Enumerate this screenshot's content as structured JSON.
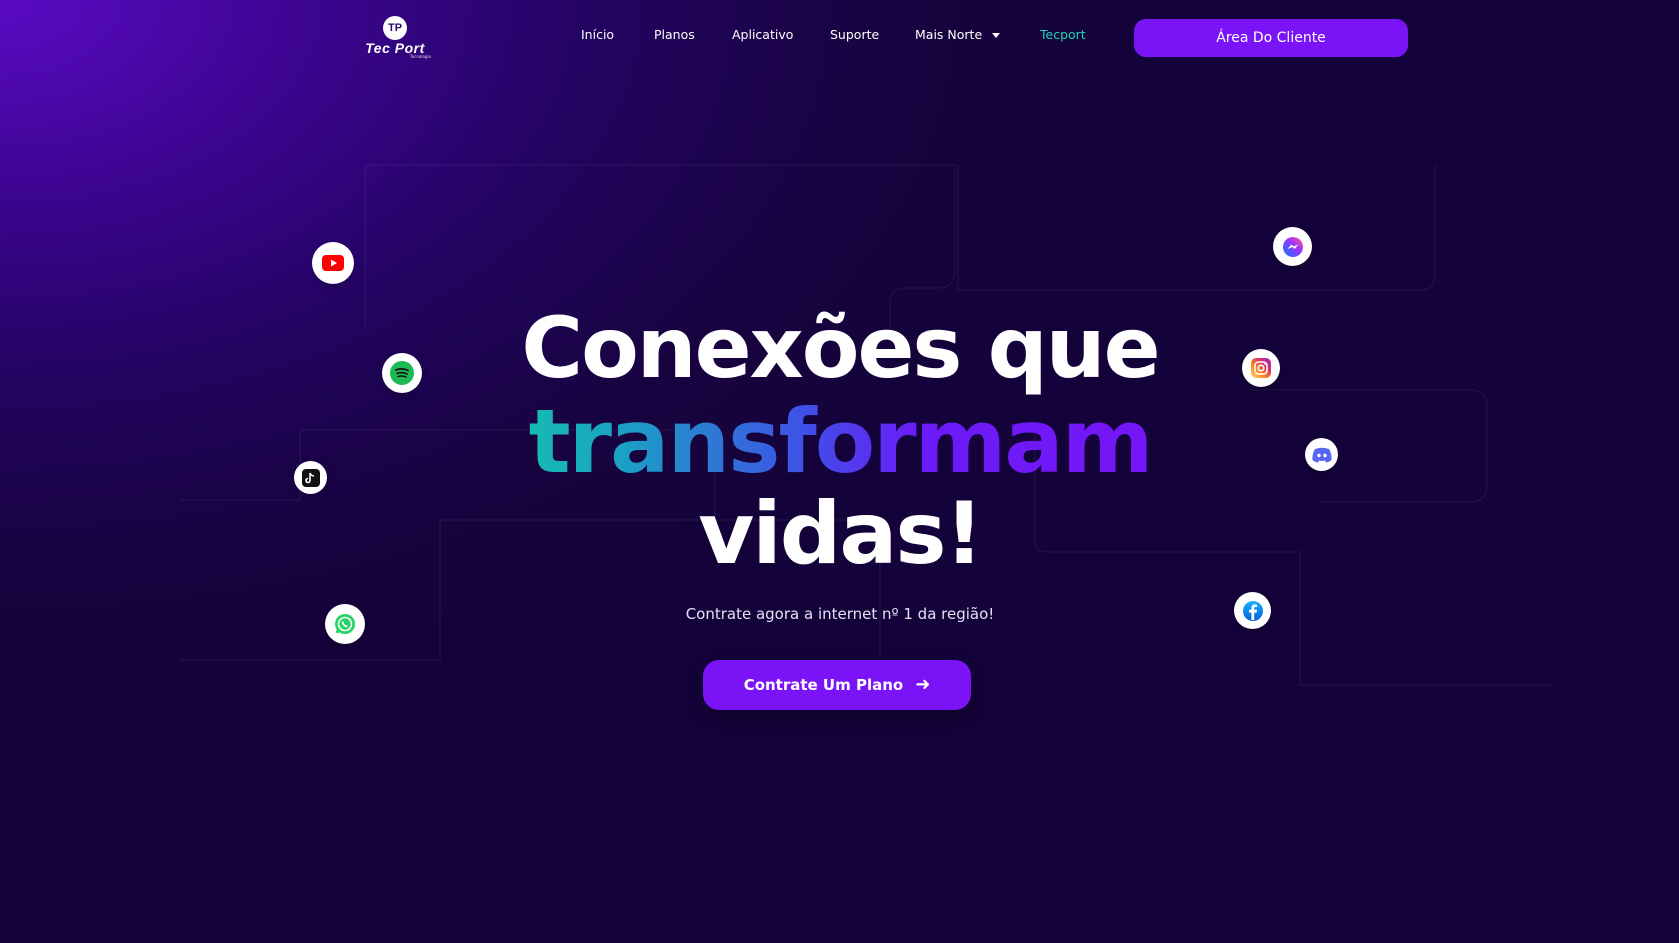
{
  "brand": {
    "logo_mark": "TP",
    "name": "Tec Port",
    "tagline": "Tecnologia"
  },
  "nav": {
    "items": [
      {
        "label": "Início"
      },
      {
        "label": "Planos"
      },
      {
        "label": "Aplicativo"
      },
      {
        "label": "Suporte"
      },
      {
        "label": "Mais Norte"
      },
      {
        "label": "Tecport"
      }
    ],
    "client_button": "Área Do Cliente"
  },
  "hero": {
    "line1": "Conexões que",
    "line2": "transformam",
    "line3": "vidas!",
    "subtitle": "Contrate agora a internet nº 1 da região!",
    "cta_label": "Contrate Um Plano"
  },
  "social_icons": [
    "youtube-icon",
    "spotify-icon",
    "tiktok-icon",
    "whatsapp-icon",
    "messenger-icon",
    "instagram-icon",
    "discord-icon",
    "facebook-icon"
  ],
  "colors": {
    "accent": "#7a14f7",
    "active_nav": "#21d4b0",
    "gradient_start": "#12d39f",
    "gradient_end": "#7a14f7"
  }
}
